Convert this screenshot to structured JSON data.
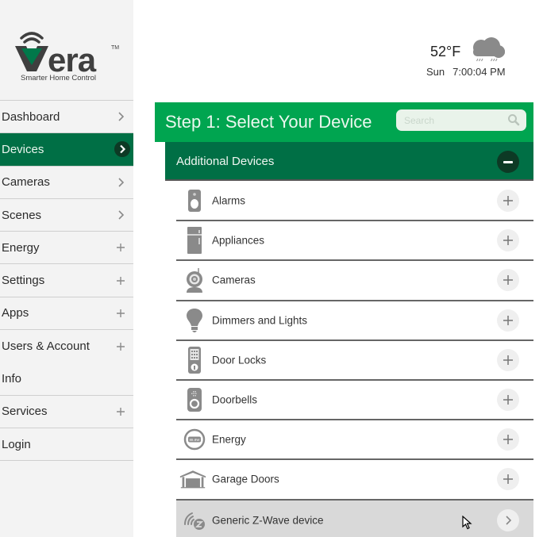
{
  "logo": {
    "brand": "vera",
    "trademark": "TM",
    "tagline": "Smarter Home Control"
  },
  "sidebar": {
    "items": [
      {
        "label": "Dashboard",
        "icon": "chevron-right-icon",
        "active": false
      },
      {
        "label": "Devices",
        "icon": "chevron-right-icon",
        "active": true
      },
      {
        "label": "Cameras",
        "icon": "chevron-right-icon",
        "active": false
      },
      {
        "label": "Scenes",
        "icon": "chevron-right-icon",
        "active": false
      },
      {
        "label": "Energy",
        "icon": "plus-icon",
        "active": false
      },
      {
        "label": "Settings",
        "icon": "plus-icon",
        "active": false
      },
      {
        "label": "Apps",
        "icon": "plus-icon",
        "active": false
      },
      {
        "label": "Users & Account",
        "icon": "plus-icon",
        "active": false
      },
      {
        "label": "Info",
        "icon": "",
        "active": false
      },
      {
        "label": "Services",
        "icon": "plus-icon",
        "active": false
      },
      {
        "label": "Login",
        "icon": "",
        "active": false
      }
    ]
  },
  "weather": {
    "temperature": "52°F",
    "condition_icon": "rain-cloud-icon",
    "day": "Sun",
    "time": "7:00:04 PM"
  },
  "header": {
    "title": "Step 1: Select Your Device",
    "search_placeholder": "Search"
  },
  "section": {
    "title": "Additional Devices",
    "state": "expanded"
  },
  "devices": [
    {
      "label": "Alarms",
      "icon": "alarm-sensor-icon",
      "action": "plus-icon"
    },
    {
      "label": "Appliances",
      "icon": "refrigerator-icon",
      "action": "plus-icon"
    },
    {
      "label": "Cameras",
      "icon": "camera-icon",
      "action": "plus-icon"
    },
    {
      "label": "Dimmers and Lights",
      "icon": "lightbulb-icon",
      "action": "plus-icon"
    },
    {
      "label": "Door Locks",
      "icon": "door-lock-icon",
      "action": "plus-icon"
    },
    {
      "label": "Doorbells",
      "icon": "doorbell-icon",
      "action": "plus-icon"
    },
    {
      "label": "Energy",
      "icon": "energy-meter-icon",
      "action": "plus-icon"
    },
    {
      "label": "Garage Doors",
      "icon": "garage-icon",
      "action": "plus-icon"
    },
    {
      "label": "Generic Z-Wave device",
      "icon": "zwave-icon",
      "action": "chevron-right-icon"
    }
  ],
  "colors": {
    "primary_green": "#00a550",
    "dark_green": "#006f45",
    "darkest_green": "#0d3a25",
    "sidebar_bg": "#f3f3f3",
    "icon_gray": "#8a8a8a",
    "hover_row": "#d9d9d9"
  }
}
